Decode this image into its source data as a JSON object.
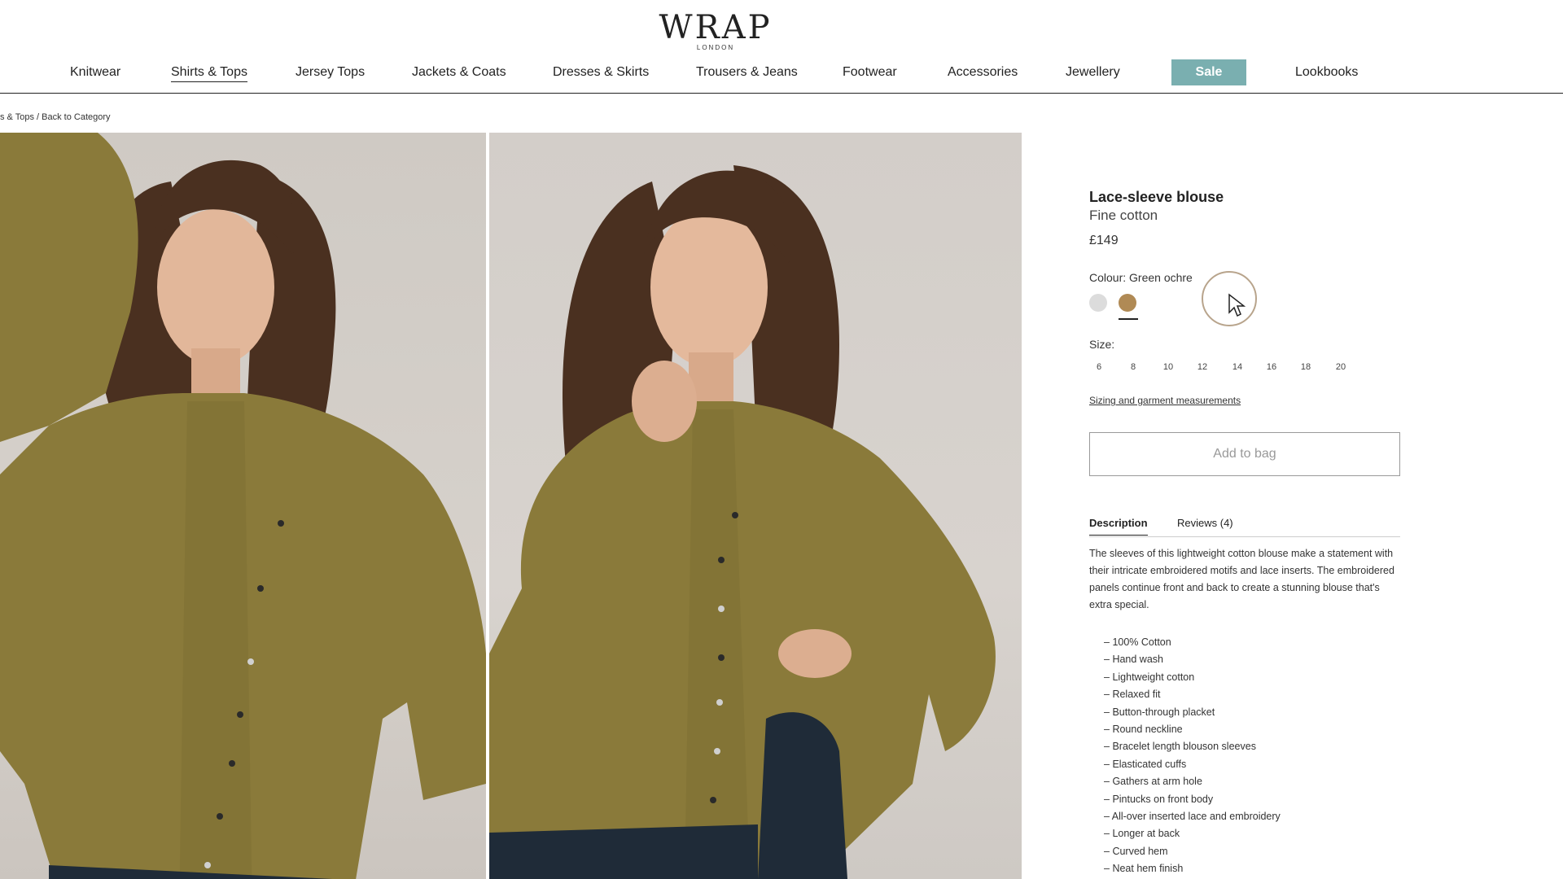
{
  "brand": {
    "name": "WRAP",
    "sub": "LONDON"
  },
  "nav": {
    "items": [
      "Knitwear",
      "Shirts & Tops",
      "Jersey Tops",
      "Jackets & Coats",
      "Dresses & Skirts",
      "Trousers & Jeans",
      "Footwear",
      "Accessories",
      "Jewellery",
      "Sale",
      "Lookbooks"
    ],
    "active": "Shirts & Tops"
  },
  "breadcrumb": "s & Tops / Back to Category",
  "product": {
    "title": "Lace-sleeve blouse",
    "subtitle": "Fine cotton",
    "price": "£149",
    "colour_label": "Colour: Green ochre",
    "swatches": [
      {
        "name": "light grey",
        "color": "#dcdcdc"
      },
      {
        "name": "green ochre",
        "color": "#b08a55"
      }
    ],
    "selected_swatch": "green ochre",
    "size_label": "Size:",
    "sizes": [
      "6",
      "8",
      "10",
      "12",
      "14",
      "16",
      "18",
      "20"
    ],
    "sizing_link": "Sizing and garment measurements",
    "add_to_bag": "Add to bag"
  },
  "tabs": [
    "Description",
    "Reviews (4)"
  ],
  "active_tab": "Description",
  "description": "The sleeves of this lightweight cotton blouse make a statement with their intricate embroidered motifs and lace inserts. The embroidered panels continue front and back to create a stunning blouse that's extra special.",
  "features": [
    "100% Cotton",
    "Hand wash",
    "Lightweight cotton",
    "Relaxed fit",
    "Button-through placket",
    "Round neckline",
    "Bracelet length blouson sleeves",
    "Elasticated cuffs",
    "Gathers at arm hole",
    "Pintucks on front body",
    "All-over inserted lace and embroidery",
    "Longer at back",
    "Curved hem",
    "Neat hem finish"
  ],
  "colors": {
    "sale": "#7aafb0",
    "garment": "#8a7a3a",
    "hair": "#4a3020",
    "denim": "#1f2b38"
  }
}
